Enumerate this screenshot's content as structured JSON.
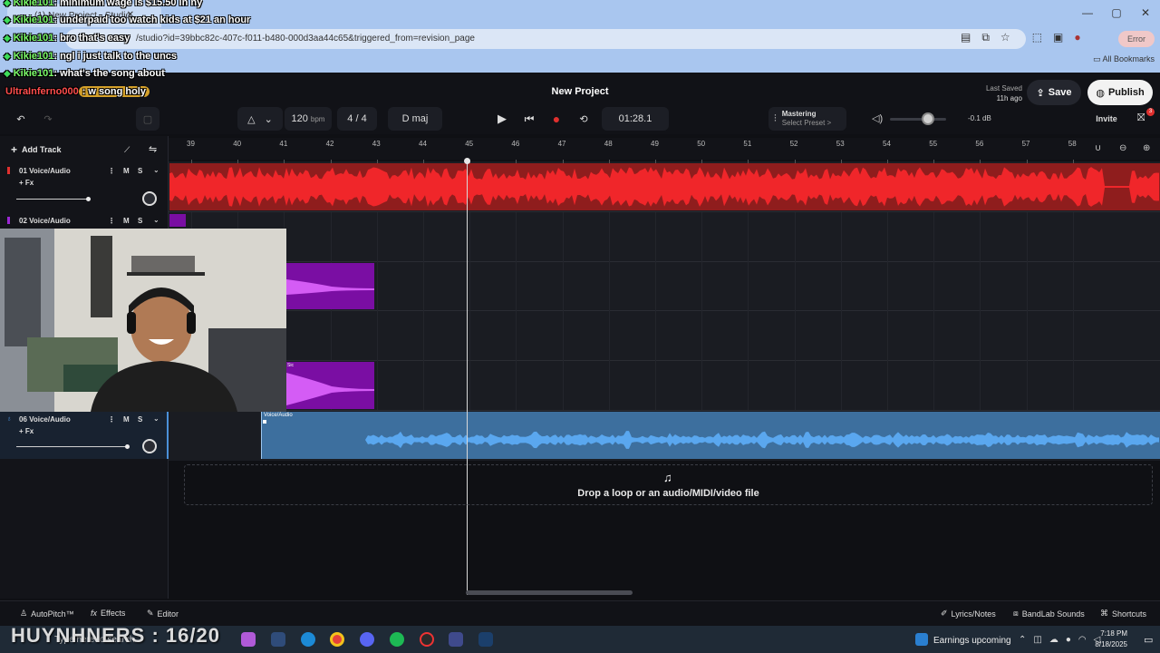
{
  "browser": {
    "tab_title": "(1) New Project - Studio",
    "url": "/studio?id=39bbc82c-407c-f011-b480-000d3aa44c65&triggered_from=revision_page",
    "error_label": "Error",
    "all_bookmarks": "All Bookmarks",
    "window_controls": [
      "—",
      "▢",
      "✕"
    ]
  },
  "chat": [
    {
      "user": "Kikie101",
      "text": ": minimum wage is $15.50 in ny"
    },
    {
      "user": "Kikie101",
      "text": ": underpaid too watch kids at $21 an hour"
    },
    {
      "user": "Kikie101",
      "text": ": bro that's easy"
    },
    {
      "user": "Kikie101",
      "text": ": ngl i just talk to the uncs"
    },
    {
      "user": "Kikie101",
      "text": ": what's the song about"
    },
    {
      "user": "UltraInferno000",
      "text": ": w song holy"
    }
  ],
  "header": {
    "project_title": "New Project",
    "last_saved_label": "Last Saved",
    "last_saved_time": "11h ago",
    "save_label": "Save",
    "publish_label": "Publish"
  },
  "toolbar": {
    "bpm_value": "120",
    "bpm_unit": "bpm",
    "time_signature": "4 / 4",
    "key": "D maj",
    "time_display": "01:28.1",
    "mastering_label": "Mastering",
    "mastering_preset": "Select Preset >",
    "volume_db": "-0.1 dB",
    "invite_label": "Invite",
    "gift_badge": "3"
  },
  "timeline": {
    "add_track_label": "Add Track",
    "ruler_ticks": [
      "39",
      "40",
      "41",
      "42",
      "43",
      "44",
      "45",
      "46",
      "47",
      "48",
      "49",
      "50",
      "51",
      "52",
      "53",
      "54",
      "55",
      "56",
      "57",
      "58"
    ]
  },
  "tracks": [
    {
      "name": "01 Voice/Audio",
      "fx": "+ Fx",
      "mute": "M",
      "solo": "S",
      "color": "#e0302e"
    },
    {
      "name": "02 Voice/Audio",
      "mute": "M",
      "solo": "S",
      "color": "#9b27d4"
    },
    {
      "name": "06 Voice/Audio",
      "fx": "+ Fx",
      "mute": "M",
      "solo": "S",
      "color": "#4a90d9",
      "clip_label": "Voice/Audio"
    }
  ],
  "purple_clip_label": "Sic",
  "drop_zone": {
    "text": "Drop a loop or an audio/MIDI/video file"
  },
  "bottom_bar": {
    "autopitch": "AutoPitch™",
    "effects": "Effects",
    "editor": "Editor",
    "lyrics": "Lyrics/Notes",
    "sounds": "BandLab Sounds",
    "shortcuts": "Shortcuts"
  },
  "taskbar": {
    "overlay_text": "HUYNHNERS : 16/20",
    "search_placeholder": "Type here to search",
    "weather": "Earnings upcoming",
    "time": "7:18 PM",
    "date": "8/18/2025"
  }
}
